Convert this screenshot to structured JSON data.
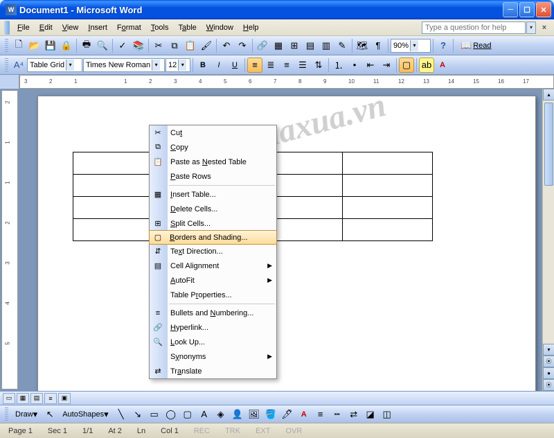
{
  "titlebar": {
    "title": "Document1 - Microsoft Word",
    "app_icon_text": "W"
  },
  "menubar": {
    "items": [
      {
        "label": "File",
        "u": "F"
      },
      {
        "label": "Edit",
        "u": "E"
      },
      {
        "label": "View",
        "u": "V"
      },
      {
        "label": "Insert",
        "u": "I"
      },
      {
        "label": "Format",
        "u": "o"
      },
      {
        "label": "Tools",
        "u": "T"
      },
      {
        "label": "Table",
        "u": "a"
      },
      {
        "label": "Window",
        "u": "W"
      },
      {
        "label": "Help",
        "u": "H"
      }
    ],
    "help_placeholder": "Type a question for help"
  },
  "toolbar1": {
    "zoom": "90%",
    "read_label": "Read"
  },
  "toolbar2": {
    "style_label": "Table Grid",
    "font_name": "Times New Roman",
    "font_size": "12"
  },
  "hruler_ticks": [
    "3",
    "2",
    "1",
    "",
    "1",
    "2",
    "3",
    "4",
    "5",
    "6",
    "7",
    "8",
    "9",
    "10",
    "11",
    "12",
    "13",
    "14",
    "15",
    "16",
    "17"
  ],
  "vruler_ticks": [
    "2",
    "1",
    "1",
    "2",
    "3",
    "4",
    "5"
  ],
  "context_menu": {
    "highlighted_index": 7,
    "items": [
      {
        "label": "Cut",
        "icon": "✂",
        "u": "t"
      },
      {
        "label": "Copy",
        "icon": "⧉",
        "u": "C"
      },
      {
        "label": "Paste as Nested Table",
        "icon": "📋",
        "u": "N"
      },
      {
        "label": "Paste Rows",
        "icon": "",
        "u": "P"
      },
      {
        "sep": true
      },
      {
        "label": "Insert Table...",
        "icon": "▦",
        "u": "I"
      },
      {
        "label": "Delete Cells...",
        "icon": "",
        "u": "D"
      },
      {
        "label": "Split Cells...",
        "icon": "⊞",
        "u": "S"
      },
      {
        "label": "Borders and Shading...",
        "icon": "▢",
        "u": "B"
      },
      {
        "label": "Text Direction...",
        "icon": "⇵",
        "u": "x"
      },
      {
        "label": "Cell Alignment",
        "icon": "▤",
        "u": "g",
        "arrow": true
      },
      {
        "label": "AutoFit",
        "icon": "",
        "u": "A",
        "arrow": true
      },
      {
        "label": "Table Properties...",
        "icon": "",
        "u": "r"
      },
      {
        "sep": true
      },
      {
        "label": "Bullets and Numbering...",
        "icon": "≡",
        "u": "N"
      },
      {
        "label": "Hyperlink...",
        "icon": "🔗",
        "u": "H"
      },
      {
        "label": "Look Up...",
        "icon": "🔍",
        "u": "L"
      },
      {
        "label": "Synonyms",
        "icon": "",
        "u": "y",
        "arrow": true
      },
      {
        "label": "Translate",
        "icon": "⇄",
        "u": "a"
      }
    ]
  },
  "watermark": "buaxua.vn",
  "draw_bar": {
    "draw_label": "Draw",
    "autoshapes_label": "AutoShapes"
  },
  "status": {
    "page": "Page 1",
    "sec": "Sec 1",
    "pages": "1/1",
    "at": "At 2",
    "ln": "Ln",
    "col": "Col 1",
    "rec": "REC",
    "trk": "TRK",
    "ext": "EXT",
    "ovr": "OVR"
  }
}
